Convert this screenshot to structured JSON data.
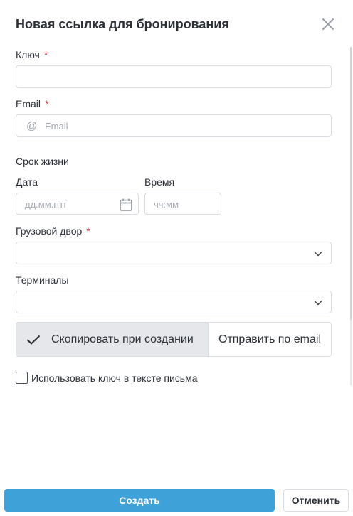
{
  "dialog": {
    "title": "Новая ссылка для бронирования",
    "close_icon": "close-icon"
  },
  "form": {
    "key": {
      "label": "Ключ",
      "required_mark": "*",
      "value": ""
    },
    "email": {
      "label": "Email",
      "required_mark": "*",
      "placeholder": "Email",
      "icon": "at-icon"
    },
    "lifetime": {
      "label": "Срок жизни",
      "date": {
        "label": "Дата",
        "placeholder": "дд.мм.гггг",
        "icon": "calendar-icon"
      },
      "time": {
        "label": "Время",
        "placeholder": "чч:мм"
      }
    },
    "cargo_yard": {
      "label": "Грузовой двор",
      "required_mark": "*",
      "value": ""
    },
    "terminals": {
      "label": "Терминалы",
      "value": ""
    },
    "delivery_mode": {
      "options": [
        "Скопировать при создании",
        "Отправить по email"
      ],
      "selected": "Скопировать при создании"
    },
    "use_key_in_email": {
      "label": "Использовать ключ в тексте письма",
      "checked": false
    }
  },
  "actions": {
    "create_label": "Создать",
    "cancel_label": "Отменить"
  },
  "colors": {
    "primary": "#3ea1d8",
    "required": "#e0344b",
    "selected_segment": "#e6e7ea",
    "border": "#d9dde2"
  }
}
